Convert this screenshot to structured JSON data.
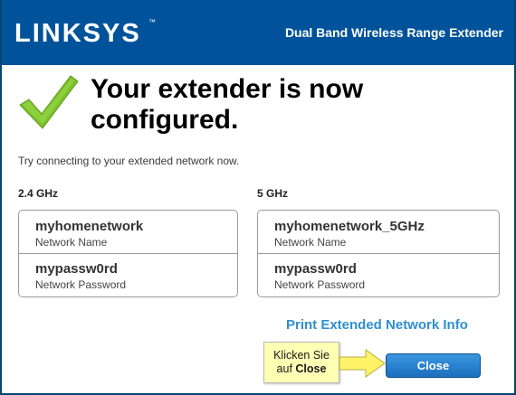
{
  "header": {
    "logo_text": "LINKSYS",
    "logo_tm": "™",
    "product_name": "Dual Band Wireless Range Extender"
  },
  "status": {
    "icon": "checkmark-icon",
    "icon_color": "#7cc22c",
    "headline": "Your extender is now configured.",
    "instruction": "Try connecting to your extended network now."
  },
  "networks": [
    {
      "band": "2.4 GHz",
      "network_name": "myhomenetwork",
      "network_name_label": "Network Name",
      "password": "mypassw0rd",
      "password_label": "Network Password"
    },
    {
      "band": "5 GHz",
      "network_name": "myhomenetwork_5GHz",
      "network_name_label": "Network Name",
      "password": "mypassw0rd",
      "password_label": "Network Password"
    }
  ],
  "actions": {
    "print_link": "Print Extended Network Info",
    "close_label": "Close"
  },
  "tooltip": {
    "line1": "Klicken Sie",
    "line2_prefix": "auf ",
    "line2_bold": "Close"
  },
  "colors": {
    "header_bg": "#00539b",
    "link": "#2f8fcf",
    "button": "#1d6fbf",
    "tooltip_bg": "#ffffb4",
    "arrow": "#fff36a"
  }
}
